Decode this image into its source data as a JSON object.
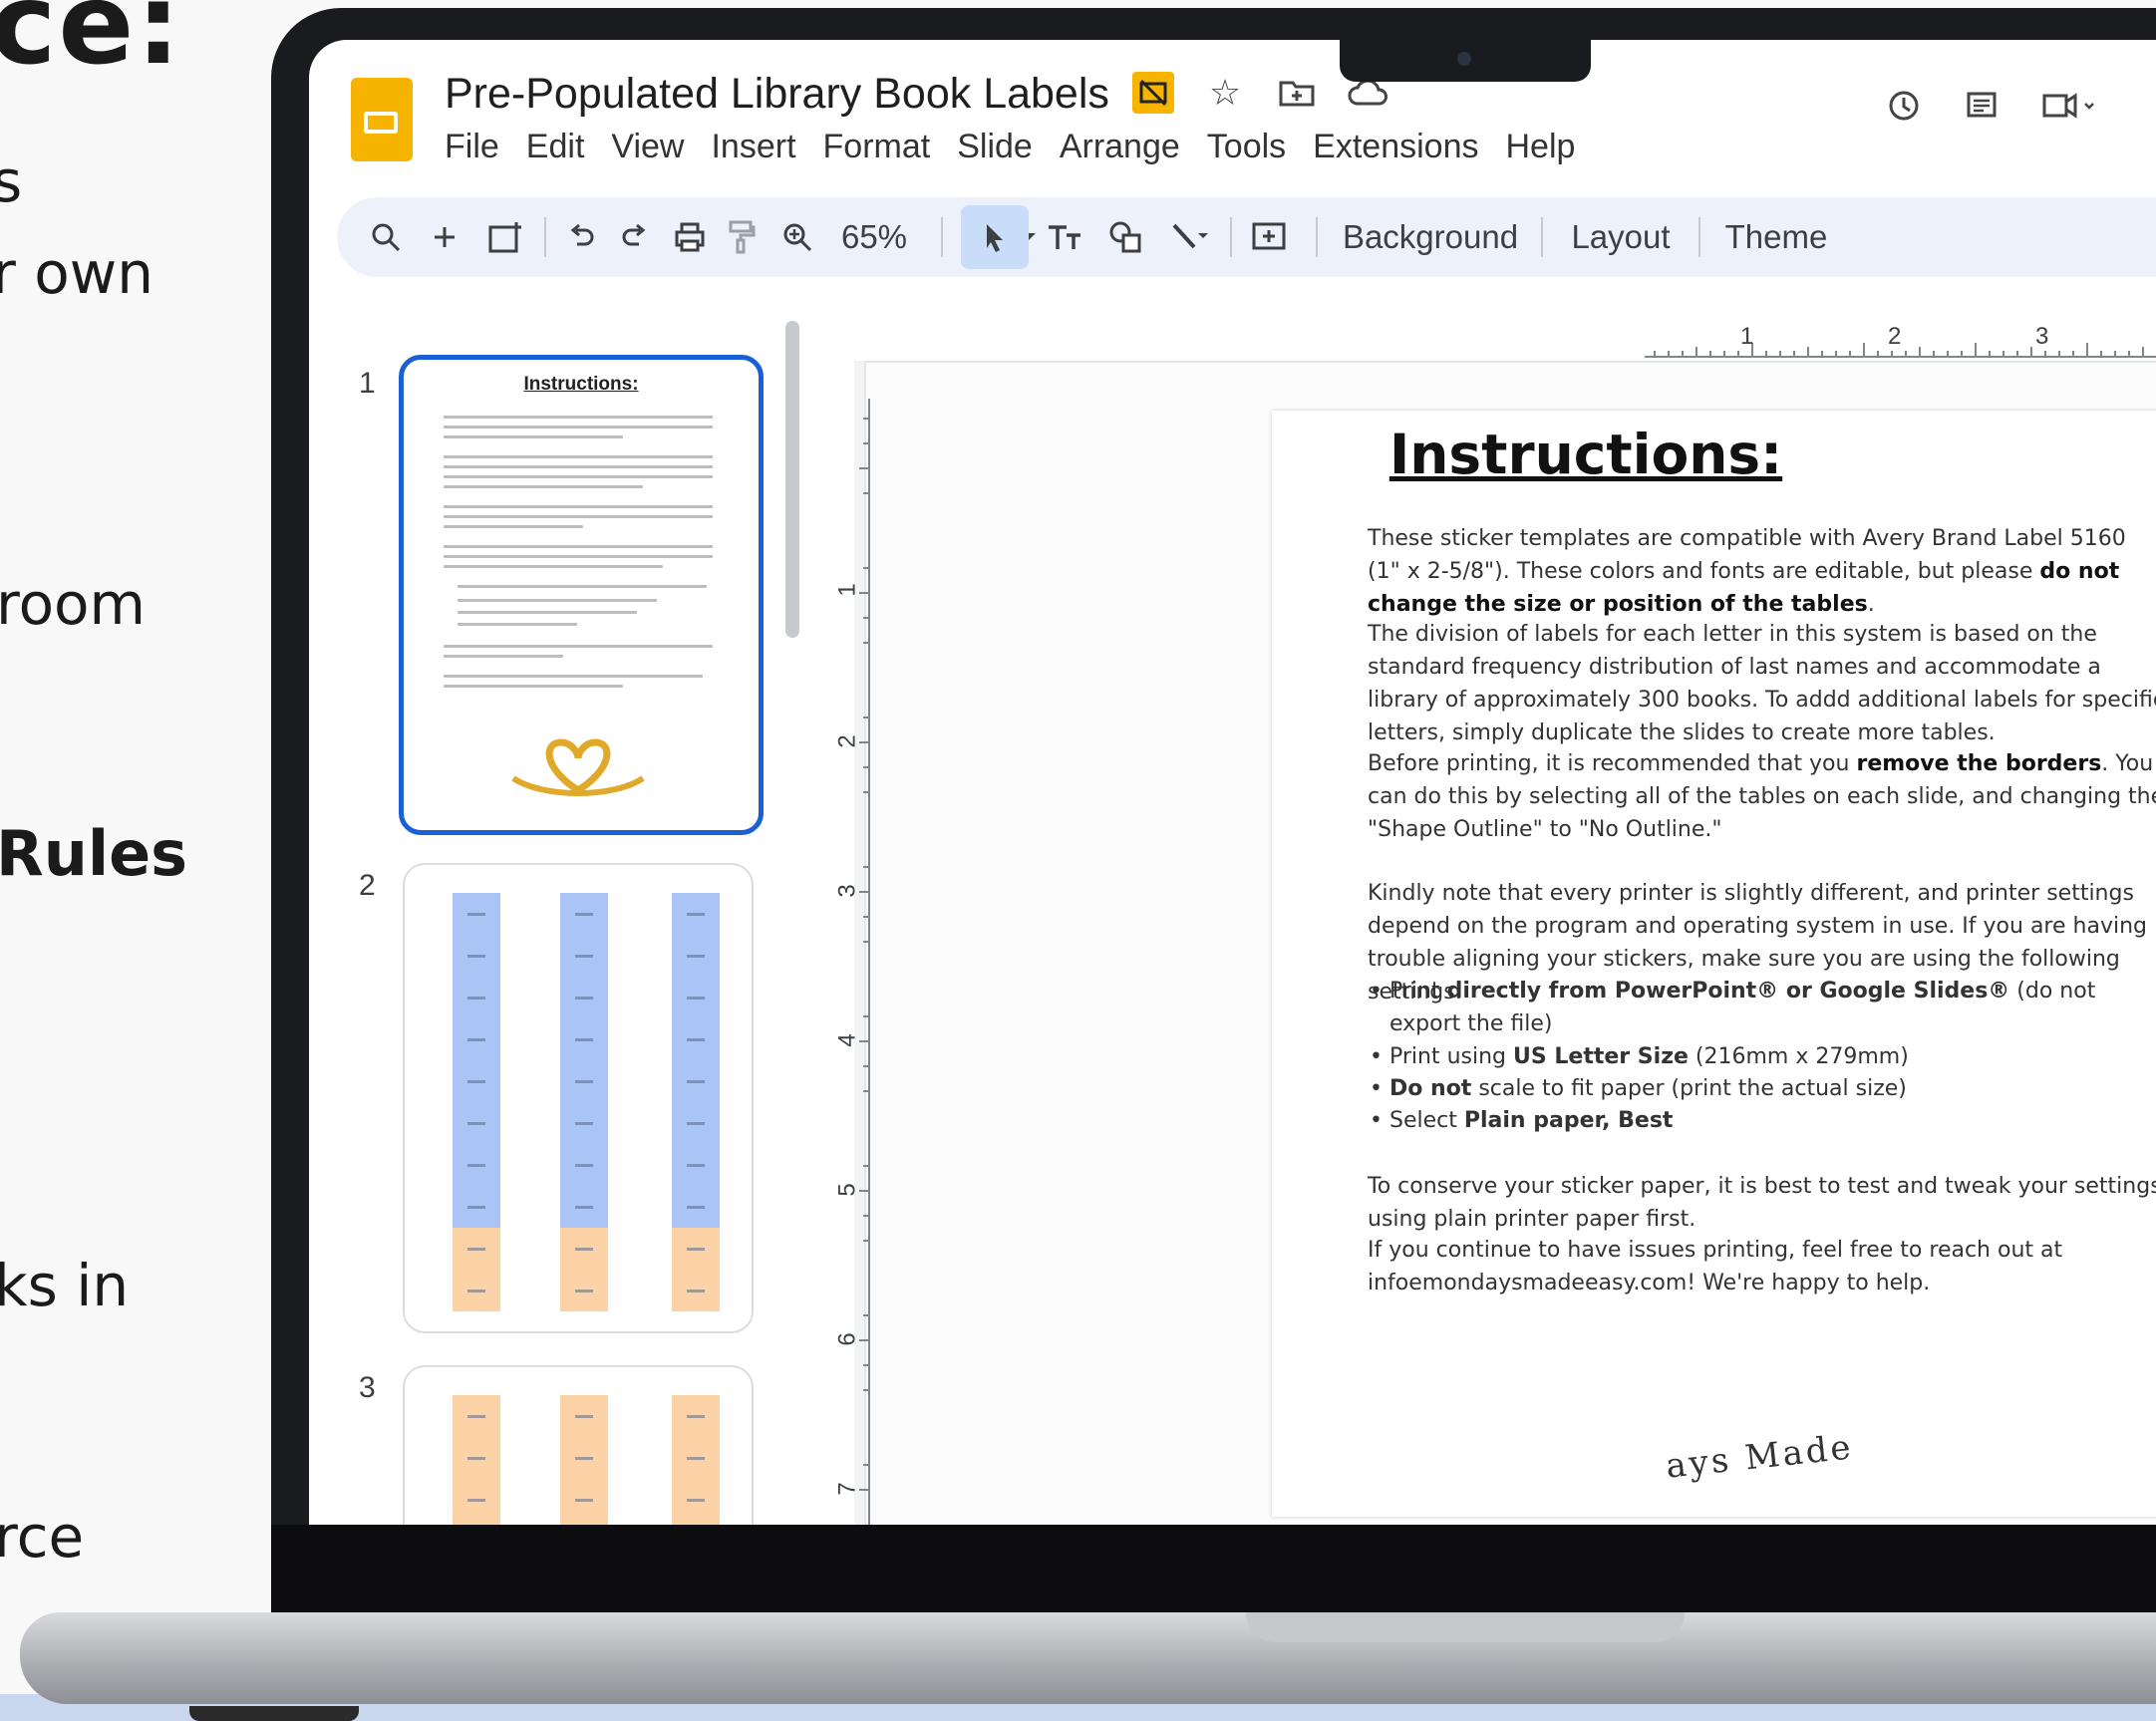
{
  "side_copy": {
    "heading_fragment": "ce:",
    "line_1": "s",
    "line_2": "r own",
    "line_3": "room",
    "line_4": "Rules",
    "line_5": "ks in",
    "line_6": "rce"
  },
  "app": {
    "title": "Pre-Populated Library Book Labels",
    "title_icons": [
      "slides-badge-icon",
      "star-icon",
      "move-to-folder-icon",
      "cloud-status-icon"
    ],
    "menu": [
      "File",
      "Edit",
      "View",
      "Insert",
      "Format",
      "Slide",
      "Arrange",
      "Tools",
      "Extensions",
      "Help"
    ],
    "top_right_icons": [
      "history-icon",
      "comments-icon",
      "meet-icon"
    ]
  },
  "toolbar": {
    "zoom": "65%",
    "background_label": "Background",
    "layout_label": "Layout",
    "theme_label": "Theme"
  },
  "ruler": {
    "top": [
      "1",
      "2",
      "3"
    ],
    "left": [
      "1",
      "2",
      "3",
      "4",
      "5",
      "6",
      "7"
    ]
  },
  "filmstrip": {
    "numbers": [
      "1",
      "2",
      "3"
    ],
    "thumb1_title": "Instructions:"
  },
  "slide": {
    "title": "Instructions:",
    "p1_a": "These sticker templates are compatible with Avery Brand Label 5160 (1\" x 2-5/8\"). These colors and fonts are editable, but please ",
    "p1_b": "do not change the size or position of the tables",
    "p1_c": ".",
    "p2": "The division of labels for each letter in this system is based on the standard frequency distribution of last names and accommodate a library of approximately 300 books. To addd additional labels for specific letters, simply duplicate the slides to create more tables.",
    "p3_a": "Before printing, it is recommended that you ",
    "p3_b": "remove the borders",
    "p3_c": ". You can do this by selecting all of the tables on each slide, and changing the \"Shape Outline\" to \"No Outline.\"",
    "p4": "Kindly note that every printer is slightly different, and printer settings depend on the program and operating system in use. If you are having trouble aligning your stickers, make sure you are using the following settings:",
    "b1_a": "Print ",
    "b1_b": "directly from PowerPoint® or Google Slides®",
    "b1_c": " (do not export the file)",
    "b2_a": "Print using ",
    "b2_b": "US Letter Size",
    "b2_c": " (216mm x 279mm)",
    "b3_a": "Do not",
    "b3_b": " scale to fit paper (print the actual size)",
    "b4_a": "Select ",
    "b4_b": "Plain paper, Best",
    "p5": "To conserve your sticker paper, it is best to test and tweak your settings using plain printer paper first.",
    "p6": "If you continue to have issues printing, feel free to reach out at infoemondaysmadeeasy.com! We're happy to help.",
    "signature_fragment": "ays Made"
  },
  "colors": {
    "label_blue": "#a9c4f5",
    "label_orange": "#fbd3a6",
    "accent": "#1a5fd6",
    "slides_yellow": "#f6b400"
  }
}
